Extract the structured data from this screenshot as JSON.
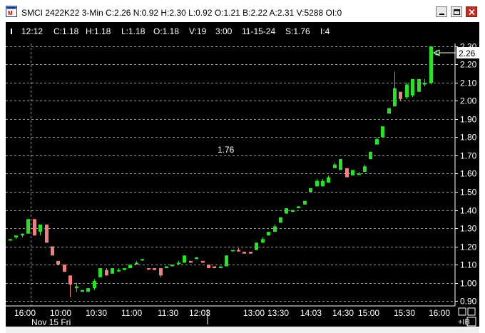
{
  "window": {
    "title": "SMCI 2422K22 3-Min C:2.26 N:0.92 H:2.30 L:0.92 O:1.21 B:2.22 A:2.31 V:5288 OI:0"
  },
  "header": {
    "time": "12:12",
    "close": "C:1.18",
    "high": "H:1.18",
    "low": "L:1.18",
    "open": "O:1.18",
    "volume": "V:19",
    "interval": "3:00",
    "date": "11-15-24",
    "s_value": "S:1.76",
    "i_value": "I:4"
  },
  "annotations": {
    "marker_label": "1.76",
    "last_price": "2.26"
  },
  "bottom_controls": {
    "ib_label": "+IB"
  },
  "colors": {
    "up": "#22e622",
    "down": "#f08080",
    "background": "#000000",
    "grid": "#9a9a9a",
    "text": "#ffffff"
  },
  "chart_data": {
    "type": "candlestick",
    "x_ticks": [
      "16:00",
      "10:00",
      "10:30",
      "11:00",
      "11:30",
      "12:03",
      "13:00",
      "13:30",
      "14:03",
      "14:30",
      "15:00",
      "15:30",
      "16:00"
    ],
    "x_sublabel": "Nov 15 Fri",
    "y_ticks": [
      "0.90",
      "1.00",
      "1.10",
      "1.20",
      "1.30",
      "1.40",
      "1.50",
      "1.60",
      "1.70",
      "1.80",
      "1.90",
      "2.00",
      "2.10",
      "2.20",
      "2.30"
    ],
    "ylim": [
      0.88,
      2.32
    ],
    "grid": "dashed",
    "candles": [
      {
        "o": 1.24,
        "h": 1.24,
        "l": 1.23,
        "c": 1.24,
        "dir": "up"
      },
      {
        "o": 1.25,
        "h": 1.26,
        "l": 1.24,
        "c": 1.26,
        "dir": "up"
      },
      {
        "o": 1.26,
        "h": 1.27,
        "l": 1.25,
        "c": 1.27,
        "dir": "up"
      },
      {
        "o": 1.27,
        "h": 1.35,
        "l": 1.27,
        "c": 1.35,
        "dir": "up"
      },
      {
        "o": 1.35,
        "h": 1.35,
        "l": 1.26,
        "c": 1.26,
        "dir": "down"
      },
      {
        "o": 1.28,
        "h": 1.32,
        "l": 1.26,
        "c": 1.32,
        "dir": "up"
      },
      {
        "o": 1.32,
        "h": 1.32,
        "l": 1.22,
        "c": 1.22,
        "dir": "down"
      },
      {
        "o": 1.2,
        "h": 1.2,
        "l": 1.15,
        "c": 1.15,
        "dir": "down"
      },
      {
        "o": 1.12,
        "h": 1.12,
        "l": 1.1,
        "c": 1.1,
        "dir": "down"
      },
      {
        "o": 1.1,
        "h": 1.1,
        "l": 1.06,
        "c": 1.06,
        "dir": "down"
      },
      {
        "o": 1.04,
        "h": 1.04,
        "l": 0.92,
        "c": 0.99,
        "dir": "down"
      },
      {
        "o": 0.97,
        "h": 1.0,
        "l": 0.95,
        "c": 0.98,
        "dir": "up"
      },
      {
        "o": 0.95,
        "h": 0.96,
        "l": 0.95,
        "c": 0.96,
        "dir": "up"
      },
      {
        "o": 0.95,
        "h": 0.97,
        "l": 0.95,
        "c": 0.97,
        "dir": "up"
      },
      {
        "o": 0.97,
        "h": 1.02,
        "l": 0.96,
        "c": 1.01,
        "dir": "up"
      },
      {
        "o": 1.03,
        "h": 1.08,
        "l": 1.03,
        "c": 1.08,
        "dir": "up"
      },
      {
        "o": 1.07,
        "h": 1.08,
        "l": 1.04,
        "c": 1.04,
        "dir": "down"
      },
      {
        "o": 1.05,
        "h": 1.08,
        "l": 1.05,
        "c": 1.08,
        "dir": "up"
      },
      {
        "o": 1.07,
        "h": 1.08,
        "l": 1.06,
        "c": 1.07,
        "dir": "up"
      },
      {
        "o": 1.07,
        "h": 1.08,
        "l": 1.07,
        "c": 1.08,
        "dir": "up"
      },
      {
        "o": 1.08,
        "h": 1.1,
        "l": 1.08,
        "c": 1.1,
        "dir": "up"
      },
      {
        "o": 1.1,
        "h": 1.12,
        "l": 1.1,
        "c": 1.11,
        "dir": "up"
      },
      {
        "o": 1.13,
        "h": 1.13,
        "l": 1.12,
        "c": 1.13,
        "dir": "up"
      },
      {
        "o": 1.08,
        "h": 1.08,
        "l": 1.07,
        "c": 1.08,
        "dir": "down"
      },
      {
        "o": 1.08,
        "h": 1.08,
        "l": 1.07,
        "c": 1.07,
        "dir": "down"
      },
      {
        "o": 1.08,
        "h": 1.08,
        "l": 1.03,
        "c": 1.04,
        "dir": "down"
      },
      {
        "o": 1.08,
        "h": 1.09,
        "l": 1.08,
        "c": 1.09,
        "dir": "up"
      },
      {
        "o": 1.09,
        "h": 1.1,
        "l": 1.09,
        "c": 1.1,
        "dir": "up"
      },
      {
        "o": 1.11,
        "h": 1.12,
        "l": 1.1,
        "c": 1.11,
        "dir": "up"
      },
      {
        "o": 1.11,
        "h": 1.15,
        "l": 1.11,
        "c": 1.15,
        "dir": "up"
      },
      {
        "o": 1.12,
        "h": 1.12,
        "l": 1.11,
        "c": 1.11,
        "dir": "down"
      },
      {
        "o": 1.13,
        "h": 1.14,
        "l": 1.13,
        "c": 1.14,
        "dir": "up"
      },
      {
        "o": 1.12,
        "h": 1.12,
        "l": 1.11,
        "c": 1.11,
        "dir": "down"
      },
      {
        "o": 1.1,
        "h": 1.1,
        "l": 1.08,
        "c": 1.08,
        "dir": "down"
      },
      {
        "o": 1.09,
        "h": 1.09,
        "l": 1.08,
        "c": 1.08,
        "dir": "down"
      },
      {
        "o": 1.08,
        "h": 1.09,
        "l": 1.08,
        "c": 1.09,
        "dir": "up"
      },
      {
        "o": 1.09,
        "h": 1.15,
        "l": 1.09,
        "c": 1.15,
        "dir": "up"
      },
      {
        "o": 1.18,
        "h": 1.18,
        "l": 1.18,
        "c": 1.18,
        "dir": "up"
      },
      {
        "o": 1.18,
        "h": 1.19,
        "l": 1.17,
        "c": 1.18,
        "dir": "down"
      },
      {
        "o": 1.17,
        "h": 1.17,
        "l": 1.16,
        "c": 1.16,
        "dir": "down"
      },
      {
        "o": 1.16,
        "h": 1.17,
        "l": 1.16,
        "c": 1.17,
        "dir": "down"
      },
      {
        "o": 1.18,
        "h": 1.22,
        "l": 1.18,
        "c": 1.22,
        "dir": "up"
      },
      {
        "o": 1.22,
        "h": 1.25,
        "l": 1.22,
        "c": 1.24,
        "dir": "up"
      },
      {
        "o": 1.26,
        "h": 1.28,
        "l": 1.26,
        "c": 1.28,
        "dir": "up"
      },
      {
        "o": 1.28,
        "h": 1.32,
        "l": 1.28,
        "c": 1.31,
        "dir": "up"
      },
      {
        "o": 1.33,
        "h": 1.36,
        "l": 1.33,
        "c": 1.36,
        "dir": "up"
      },
      {
        "o": 1.38,
        "h": 1.41,
        "l": 1.38,
        "c": 1.41,
        "dir": "up"
      },
      {
        "o": 1.39,
        "h": 1.4,
        "l": 1.39,
        "c": 1.4,
        "dir": "up"
      },
      {
        "o": 1.41,
        "h": 1.42,
        "l": 1.41,
        "c": 1.42,
        "dir": "up"
      },
      {
        "o": 1.43,
        "h": 1.45,
        "l": 1.43,
        "c": 1.45,
        "dir": "up"
      },
      {
        "o": 1.5,
        "h": 1.52,
        "l": 1.5,
        "c": 1.52,
        "dir": "up"
      },
      {
        "o": 1.53,
        "h": 1.57,
        "l": 1.53,
        "c": 1.56,
        "dir": "up"
      },
      {
        "o": 1.53,
        "h": 1.57,
        "l": 1.53,
        "c": 1.56,
        "dir": "up"
      },
      {
        "o": 1.55,
        "h": 1.59,
        "l": 1.55,
        "c": 1.58,
        "dir": "up"
      },
      {
        "o": 1.63,
        "h": 1.66,
        "l": 1.63,
        "c": 1.65,
        "dir": "up"
      },
      {
        "o": 1.62,
        "h": 1.68,
        "l": 1.62,
        "c": 1.68,
        "dir": "up"
      },
      {
        "o": 1.63,
        "h": 1.63,
        "l": 1.58,
        "c": 1.58,
        "dir": "down"
      },
      {
        "o": 1.59,
        "h": 1.62,
        "l": 1.59,
        "c": 1.62,
        "dir": "up"
      },
      {
        "o": 1.6,
        "h": 1.61,
        "l": 1.6,
        "c": 1.6,
        "dir": "up"
      },
      {
        "o": 1.61,
        "h": 1.65,
        "l": 1.61,
        "c": 1.64,
        "dir": "up"
      },
      {
        "o": 1.68,
        "h": 1.72,
        "l": 1.68,
        "c": 1.72,
        "dir": "up"
      },
      {
        "o": 1.76,
        "h": 1.8,
        "l": 1.76,
        "c": 1.79,
        "dir": "up"
      },
      {
        "o": 1.8,
        "h": 1.86,
        "l": 1.8,
        "c": 1.86,
        "dir": "up"
      },
      {
        "o": 1.93,
        "h": 1.96,
        "l": 1.93,
        "c": 1.96,
        "dir": "up"
      },
      {
        "o": 1.97,
        "h": 2.16,
        "l": 1.97,
        "c": 2.07,
        "dir": "up"
      },
      {
        "o": 2.05,
        "h": 2.05,
        "l": 2.0,
        "c": 2.01,
        "dir": "down"
      },
      {
        "o": 2.02,
        "h": 2.1,
        "l": 2.01,
        "c": 2.09,
        "dir": "up"
      },
      {
        "o": 2.03,
        "h": 2.12,
        "l": 2.02,
        "c": 2.12,
        "dir": "up"
      },
      {
        "o": 2.05,
        "h": 2.12,
        "l": 2.05,
        "c": 2.12,
        "dir": "up"
      },
      {
        "o": 2.09,
        "h": 2.12,
        "l": 2.08,
        "c": 2.1,
        "dir": "up"
      },
      {
        "o": 2.1,
        "h": 2.3,
        "l": 2.09,
        "c": 2.3,
        "dir": "up"
      },
      {
        "o": 2.26,
        "h": 2.28,
        "l": 2.25,
        "c": 2.26,
        "dir": "up"
      }
    ]
  }
}
